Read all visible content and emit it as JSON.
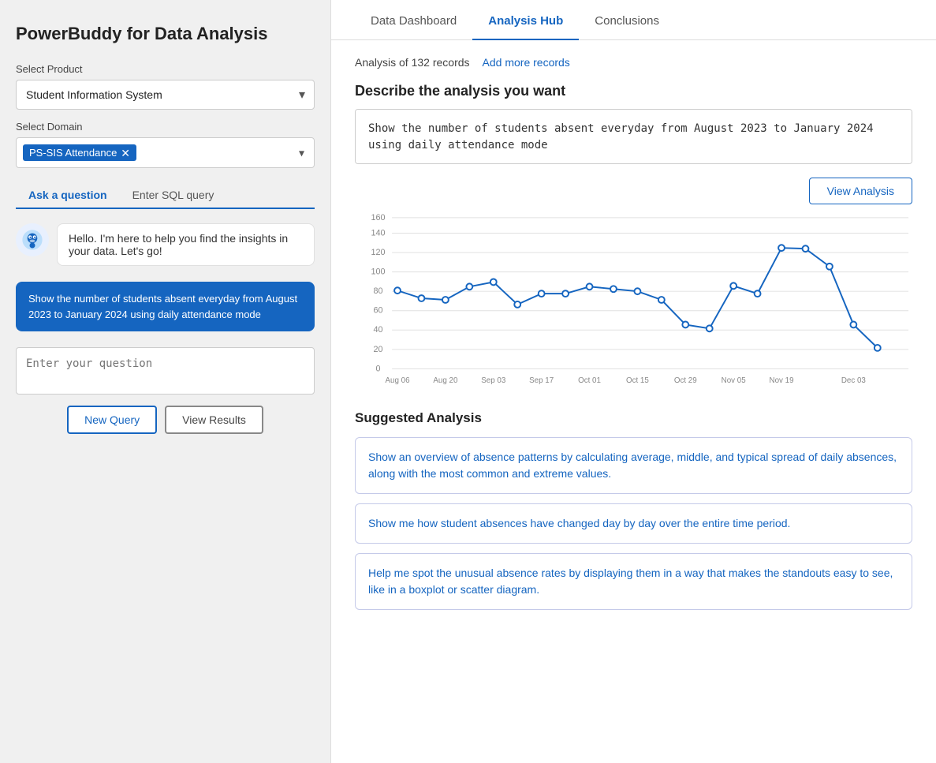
{
  "app": {
    "title": "PowerBuddy for Data Analysis"
  },
  "left_panel": {
    "select_product_label": "Select Product",
    "product_value": "Student Information System",
    "select_domain_label": "Select Domain",
    "domain_tag": "PS-SIS Attendance",
    "tab_ask": "Ask a question",
    "tab_sql": "Enter SQL query",
    "bot_message": "Hello. I'm here to help you find the insights in your data. Let's go!",
    "query_text": "Show the number of students absent everyday from August 2023 to January 2024 using daily attendance mode",
    "question_placeholder": "Enter your question",
    "btn_new_query": "New Query",
    "btn_view_results": "View Results"
  },
  "right_panel": {
    "tabs": [
      {
        "id": "data-dashboard",
        "label": "Data Dashboard"
      },
      {
        "id": "analysis-hub",
        "label": "Analysis Hub"
      },
      {
        "id": "conclusions",
        "label": "Conclusions"
      }
    ],
    "active_tab": "analysis-hub",
    "records_text": "Analysis of 132 records",
    "add_records_link": "Add more records",
    "describe_label": "Describe the analysis you want",
    "analysis_text": "Show the number of students absent everyday from August 2023 to January 2024 using daily attendance mode",
    "btn_view_analysis": "View Analysis",
    "suggested_label": "Suggested Analysis",
    "suggestions": [
      "Show an overview of absence patterns by calculating average, middle, and typical spread of daily absences, along with the most common and extreme values.",
      "Show me how student absences have changed day by day over the entire time period.",
      "Help me spot the unusual absence rates by displaying them in a way that makes the standouts easy to see, like in a boxplot or scatter diagram."
    ],
    "chart": {
      "x_labels": [
        "Aug 06",
        "Aug 20",
        "Sep 03",
        "Sep 17",
        "Oct 01",
        "Oct 15",
        "Oct 29",
        "Nov 05",
        "Nov 19",
        "Dec 03"
      ],
      "y_labels": [
        "0",
        "20",
        "40",
        "60",
        "80",
        "100",
        "120",
        "140",
        "160"
      ],
      "points": [
        {
          "label": "Aug 06",
          "value": 83
        },
        {
          "label": "Aug 13",
          "value": 75
        },
        {
          "label": "Aug 20",
          "value": 73
        },
        {
          "label": "Aug 27",
          "value": 87
        },
        {
          "label": "Sep 03",
          "value": 92
        },
        {
          "label": "Sep 10",
          "value": 68
        },
        {
          "label": "Sep 17",
          "value": 80
        },
        {
          "label": "Sep 24",
          "value": 80
        },
        {
          "label": "Oct 01",
          "value": 87
        },
        {
          "label": "Oct 08",
          "value": 85
        },
        {
          "label": "Oct 15",
          "value": 82
        },
        {
          "label": "Oct 22",
          "value": 73
        },
        {
          "label": "Oct 29",
          "value": 47
        },
        {
          "label": "Nov 01",
          "value": 43
        },
        {
          "label": "Nov 05",
          "value": 88
        },
        {
          "label": "Nov 12",
          "value": 80
        },
        {
          "label": "Nov 19",
          "value": 128
        },
        {
          "label": "Nov 22",
          "value": 127
        },
        {
          "label": "Nov 26",
          "value": 108
        },
        {
          "label": "Dec 03",
          "value": 47
        },
        {
          "label": "Dec 10",
          "value": 22
        }
      ]
    }
  }
}
